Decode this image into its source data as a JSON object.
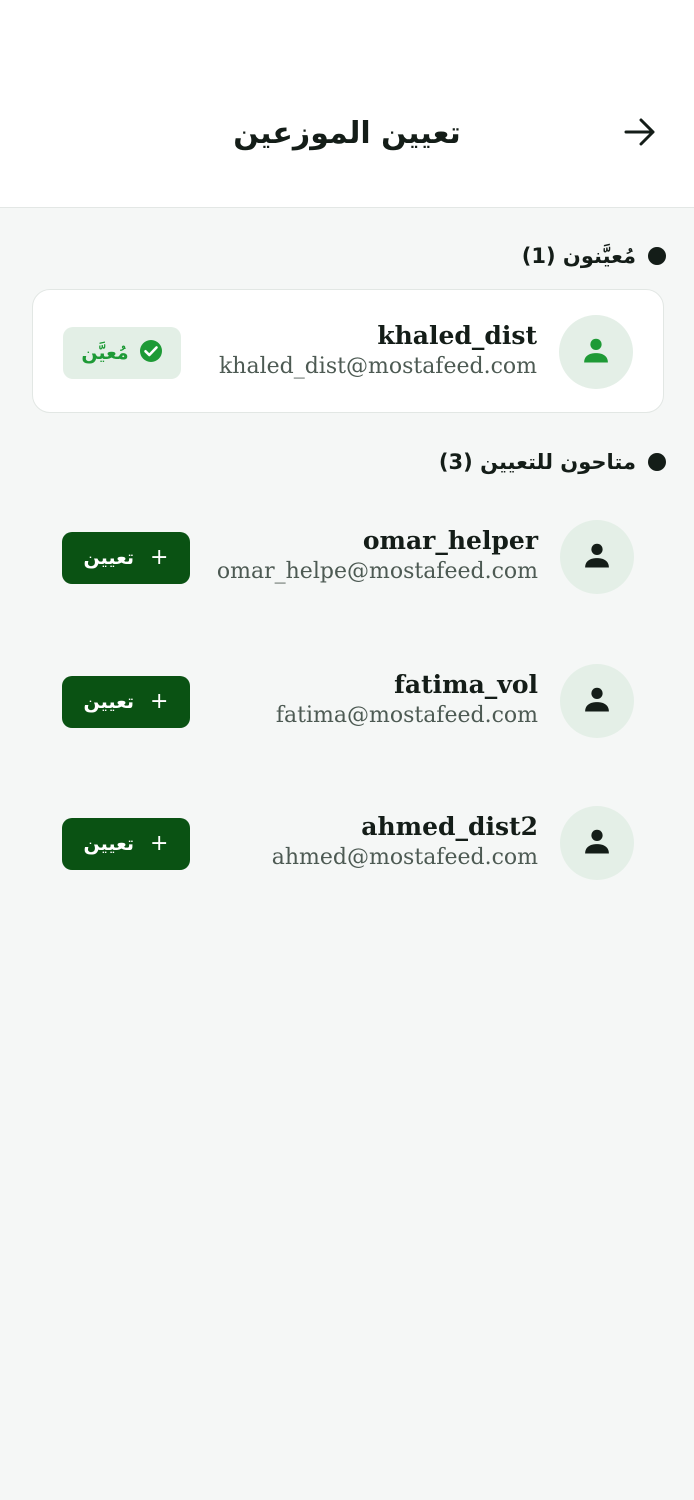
{
  "header": {
    "title": "تعيين الموزعين",
    "back_icon": "arrow-right-icon"
  },
  "assigned_section": {
    "label": "مُعيَّنون (1)",
    "users": [
      {
        "username": "khaled_dist",
        "email": "khaled_dist@mostafeed.com",
        "status_label": "مُعيَّن",
        "status_icon": "check-circle-icon"
      }
    ]
  },
  "available_section": {
    "label": "متاحون للتعيين (3)",
    "users": [
      {
        "username": "omar_helper",
        "email": "omar_helpe@mostafeed.com",
        "action_label": "تعيين",
        "action_icon": "plus-icon"
      },
      {
        "username": "fatima_vol",
        "email": "fatima@mostafeed.com",
        "action_label": "تعيين",
        "action_icon": "plus-icon"
      },
      {
        "username": "ahmed_dist2",
        "email": "ahmed@mostafeed.com",
        "action_label": "تعيين",
        "action_icon": "plus-icon"
      }
    ]
  },
  "colors": {
    "primary": "#0a5213",
    "assigned_green": "#1e9a36",
    "avatar_bg": "#e4efe7",
    "page_bg": "#f5f7f6"
  }
}
